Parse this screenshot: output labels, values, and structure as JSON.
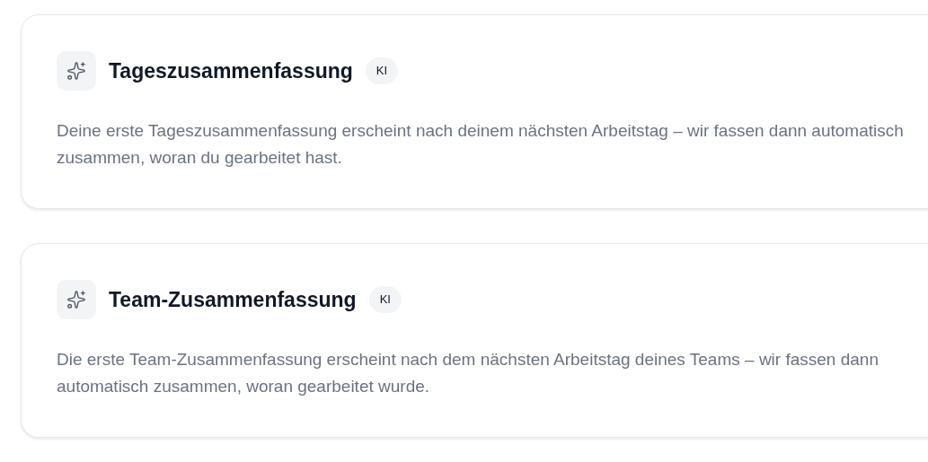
{
  "cards": [
    {
      "title": "Tageszusammenfassung",
      "badge": "KI",
      "description": "Deine erste Tageszusammenfassung erscheint nach deinem nächsten Arbeitstag – wir fassen dann automatisch zusammen, woran du gearbeitet hast."
    },
    {
      "title": "Team-Zusammenfassung",
      "badge": "KI",
      "description": "Die erste Team-Zusammenfassung erscheint nach dem nächsten Arbeitstag deines Teams – wir fassen dann automatisch zusammen, woran gearbeitet wurde."
    }
  ]
}
